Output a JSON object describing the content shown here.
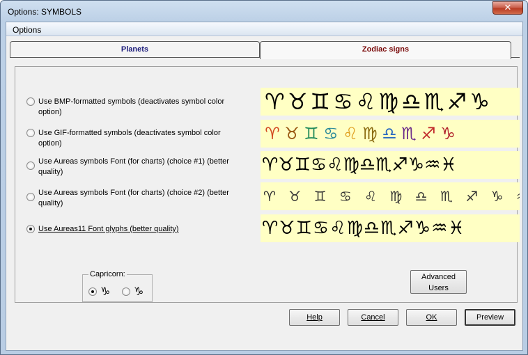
{
  "window": {
    "title": "Options: SYMBOLS",
    "close_glyph": "✕"
  },
  "menubar": {
    "options_label": "Options"
  },
  "tabs": [
    {
      "label": "Planets",
      "color": "#1a1a7a",
      "active": false
    },
    {
      "label": "Zodiac signs",
      "color": "#7a0a0a",
      "active": true
    }
  ],
  "options": [
    {
      "label": "Use BMP-formatted symbols (deactivates symbol color option)",
      "selected": false
    },
    {
      "label": "Use GIF-formatted symbols (deactivates symbol color option)",
      "selected": false
    },
    {
      "label": "Use Aureas symbols Font (for charts) (choice #1) (better quality)",
      "selected": false
    },
    {
      "label": "Use Aureas symbols Font (for charts) (choice #2) (better quality)",
      "selected": false
    },
    {
      "label": "Use Aureas11 Font glyphs (better quality)",
      "selected": true
    }
  ],
  "previews": {
    "bmp": "♈︎♉︎♊︎♋︎♌︎♍︎♎︎♏︎♐︎♑︎",
    "gif": [
      {
        "glyph": "♈︎",
        "color": "#d2461e"
      },
      {
        "glyph": "♉︎",
        "color": "#9a5a14"
      },
      {
        "glyph": "♊︎",
        "color": "#1f8a5a"
      },
      {
        "glyph": "♋︎",
        "color": "#2a8a9a"
      },
      {
        "glyph": "♌︎",
        "color": "#e0a020"
      },
      {
        "glyph": "♍︎",
        "color": "#8a6a10"
      },
      {
        "glyph": "♎︎",
        "color": "#2a6ac0"
      },
      {
        "glyph": "♏︎",
        "color": "#6a2a8a"
      },
      {
        "glyph": "♐︎",
        "color": "#c02a2a"
      },
      {
        "glyph": "♑︎",
        "color": "#b0202a"
      }
    ],
    "font1": "♈︎♉︎♊︎♋︎♌︎♍︎♎︎♏︎♐︎♑︎♒︎♓︎",
    "font2_icon": "constellation-figures",
    "font2_scene": "♈︎ ♉︎ ♊︎ ♋︎ ♌︎ ♍︎ ♎︎ ♏︎ ♐︎ ♑︎ ♒︎ ♓︎",
    "aureas11": "♈︎♉︎♊︎♋︎♌︎♍︎♎︎♏︎♐︎♑︎♒︎♓︎",
    "background": "#ffffc4"
  },
  "capricorn": {
    "caption": "Capricorn:",
    "choices": [
      {
        "glyph": "♑︎",
        "selected": true
      },
      {
        "glyph": "♑",
        "selected": false
      }
    ]
  },
  "buttons": {
    "advanced_line1": "Advanced",
    "advanced_line2": "Users",
    "help": "Help",
    "cancel": "Cancel",
    "ok": "OK",
    "preview": "Preview"
  }
}
